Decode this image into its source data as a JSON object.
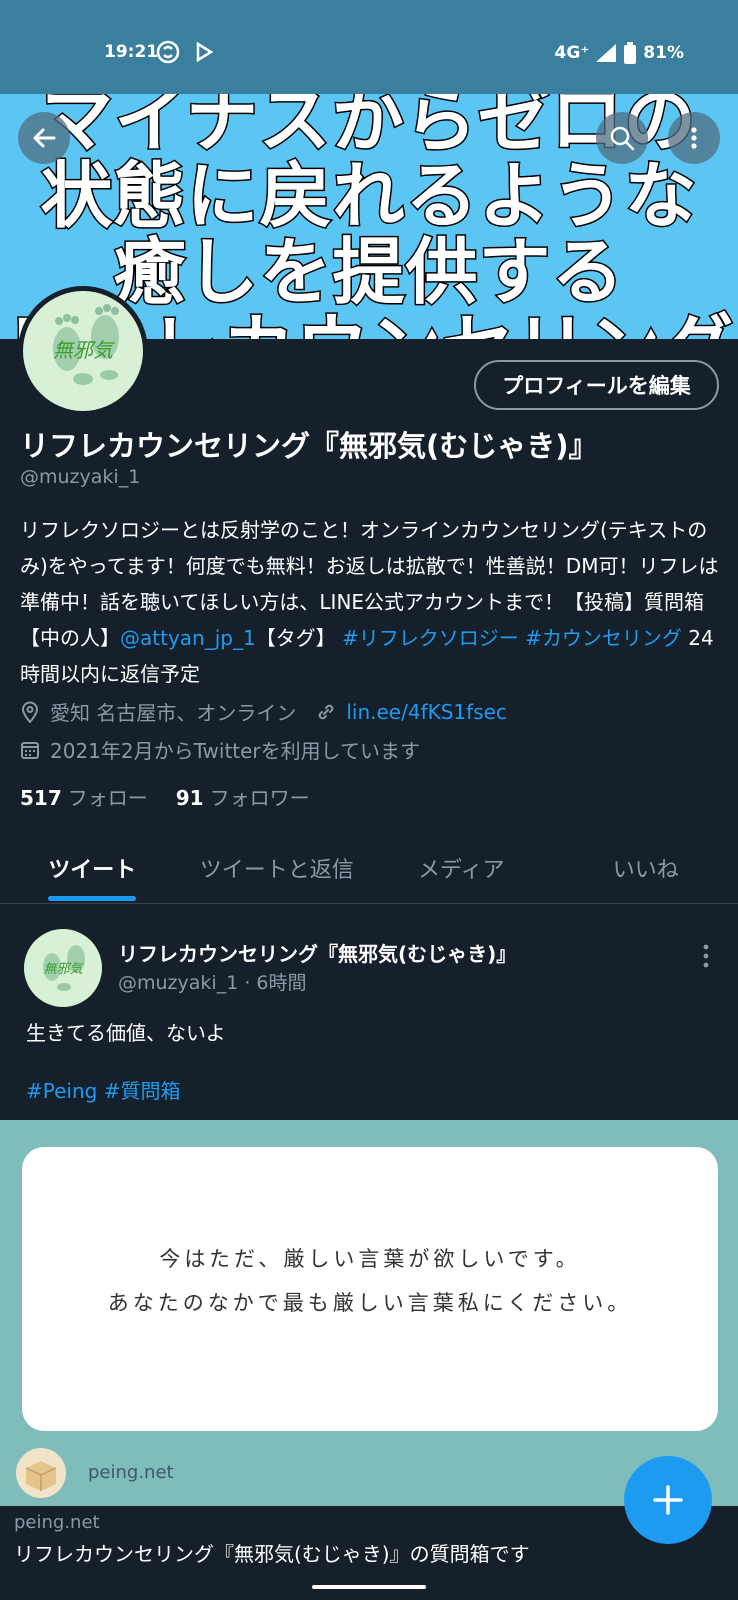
{
  "status": {
    "time": "19:21",
    "network": "4G⁺",
    "battery": "81%"
  },
  "banner": {
    "text": "マイナスからゼロの\n状態に戻れるような\n癒しを提供する\nリフレカウンセリング"
  },
  "profile": {
    "edit_label": "プロフィールを編集",
    "name": "リフレカウンセリング『無邪気(むじゃき)』",
    "handle": "@muzyaki_1",
    "bio_main": "リフレクソロジーとは反射学のこと！オンラインカウンセリング(テキストのみ)をやってます！何度でも無料！お返しは拡散で！性善説！DM可！リフレは準備中！話を聴いてほしい方は、LINE公式アカウントまで！【投稿】質問箱【中の人】",
    "bio_mention": "@attyan_jp_1",
    "bio_mid": "【タグ】 ",
    "bio_tags": "#リフレクソロジー #カウンセリング",
    "bio_end": " 24時間以内に返信予定",
    "location": "愛知 名古屋市、オンライン",
    "url": "lin.ee/4fKS1fsec",
    "joined": "2021年2月からTwitterを利用しています",
    "following_count": "517",
    "following_label": "フォロー",
    "followers_count": "91",
    "followers_label": "フォロワー",
    "avatar_text": "無邪気"
  },
  "tabs": [
    "ツイート",
    "ツイートと返信",
    "メディア",
    "いいね"
  ],
  "tweet": {
    "name": "リフレカウンセリング『無邪気(むじゃき)』",
    "sub": "@muzyaki_1 · 6時間",
    "text": "生きてる価値、ないよ",
    "tags": "#Peing #質問箱",
    "card_question": "今はただ、厳しい言葉が欲しいです。\nあなたのなかで最も厳しい言葉私にください。",
    "card_domain_small": "peing.net",
    "card_source": "peing.net",
    "card_title": "リフレカウンセリング『無邪気(むじゃき)』の質問箱です"
  },
  "colors": {
    "accent": "#1d9bf0",
    "background": "#15202b",
    "banner": "#5bc6f3",
    "statusbar": "#3b7f9e"
  },
  "icons": [
    "back-arrow-icon",
    "search-icon",
    "more-vert-icon",
    "location-icon",
    "link-icon",
    "calendar-icon",
    "compose-plus-icon"
  ]
}
